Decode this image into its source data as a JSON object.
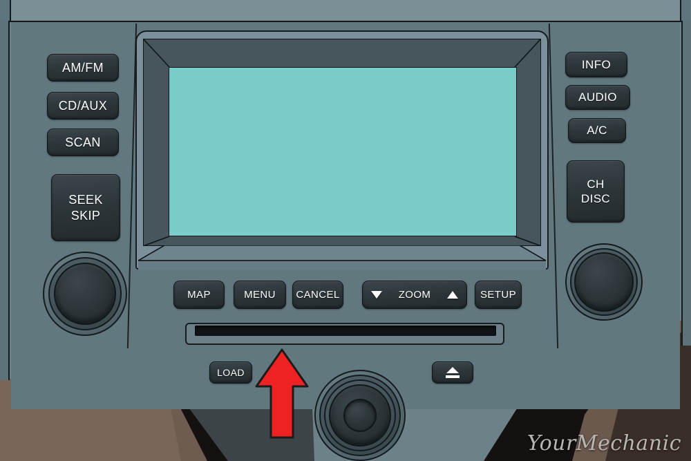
{
  "device": {
    "title": "Car Stereo Head Unit",
    "screen": {
      "state": "blank",
      "color": "#7accca"
    }
  },
  "colors": {
    "panel": "#62787f",
    "panel_light": "#7b909a",
    "button_face": "#2b3437",
    "screen_teal": "#7accca",
    "arrow_red": "#ee2222",
    "outline": "#12181b",
    "trim_brown": "#6d5c52",
    "shadow_black": "#15120f"
  },
  "left_buttons": [
    {
      "id": "am-fm",
      "label": "AM/FM"
    },
    {
      "id": "cd-aux",
      "label": "CD/AUX"
    },
    {
      "id": "scan",
      "label": "SCAN"
    }
  ],
  "seek_button": {
    "line1": "SEEK",
    "line2": "SKIP"
  },
  "right_buttons": [
    {
      "id": "info",
      "label": "INFO"
    },
    {
      "id": "audio",
      "label": "AUDIO"
    },
    {
      "id": "ac",
      "label": "A/C"
    }
  ],
  "ch_disc_button": {
    "line1": "CH",
    "line2": "DISC"
  },
  "bottom_buttons": [
    {
      "id": "map",
      "label": "MAP"
    },
    {
      "id": "menu",
      "label": "MENU"
    },
    {
      "id": "cancel",
      "label": "CANCEL"
    }
  ],
  "zoom_control": {
    "label": "ZOOM",
    "decrease_icon": "triangle-down-icon",
    "increase_icon": "triangle-up-icon"
  },
  "setup_button": {
    "label": "SETUP"
  },
  "load_button": {
    "label": "LOAD"
  },
  "eject_button": {
    "icon": "eject-icon"
  },
  "cd_slot": {
    "name": "cd-slot"
  },
  "knobs": [
    {
      "id": "left-knob",
      "function": "volume-power"
    },
    {
      "id": "right-knob",
      "function": "tune-select"
    },
    {
      "id": "bottom-knob",
      "function": "center-control"
    }
  ],
  "annotation": {
    "arrow": {
      "icon": "up-arrow-icon",
      "color": "#ee2222",
      "points_to": "cd-slot"
    }
  },
  "watermark": {
    "text": "YourMechanic"
  }
}
